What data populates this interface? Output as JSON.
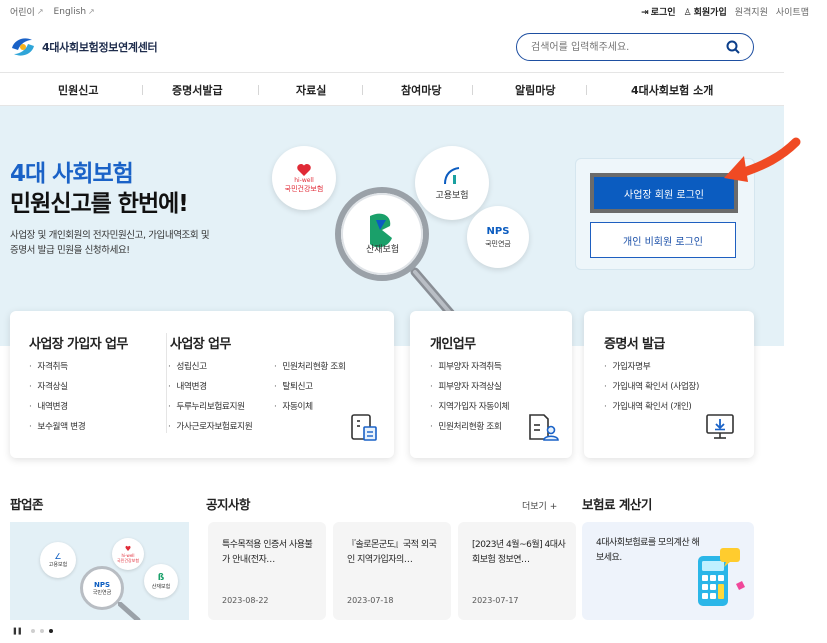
{
  "utility": {
    "lang_kids": "어린이",
    "lang_english": "English",
    "login": "로그인",
    "signup": "회원가입",
    "remote_support": "원격지원",
    "sitemap": "사이트맵"
  },
  "header": {
    "logo_text": "4대사회보험정보연계센터",
    "search_placeholder": "검색어를 입력해주세요."
  },
  "gnb": {
    "items": [
      "민원신고",
      "증명서발급",
      "자료실",
      "참여마당",
      "알림마당",
      "4대사회보험 소개"
    ]
  },
  "hero": {
    "title": "4대 사회보험",
    "subtitle": "민원신고를 한번에!",
    "desc_line1": "사업장 및 개인회원의 전자민원신고, 가입내역조회 및",
    "desc_line2": "증명서 발급 민원을 신청하세요!",
    "bubbles": {
      "health_brand": "hi-well",
      "health": "국민건강보험",
      "employment": "고용보험",
      "nps_brand": "NPS",
      "nps": "국민연금",
      "industrial": "산재보험"
    },
    "login_business": "사업장 회원 로그인",
    "login_guest": "개인 비회원 로그인"
  },
  "cards": {
    "biz_join": {
      "title": "사업장 가입자 업무",
      "items": [
        "자격취득",
        "자격상실",
        "내역변경",
        "보수월액 변경"
      ]
    },
    "biz_work": {
      "title": "사업장 업무",
      "items_col1": [
        "성립신고",
        "내역변경",
        "두루누리보험료지원",
        "가사근로자보험료지원"
      ],
      "items_col2": [
        "민원처리현황 조회",
        "탈퇴신고",
        "자동이체"
      ]
    },
    "personal": {
      "title": "개인업무",
      "items": [
        "피부양자 자격취득",
        "피부양자 자격상실",
        "지역가입자 자동이체",
        "민원처리현황 조회"
      ]
    },
    "certificate": {
      "title": "증명서 발급",
      "items": [
        "가입자명부",
        "가입내역 확인서 (사업장)",
        "가입내역 확인서 (개인)"
      ]
    }
  },
  "popup_zone": {
    "title": "팝업존",
    "mini_labels": {
      "employment": "고용보험",
      "health_brand": "hi-well",
      "health": "국민건강보험",
      "nps_brand": "NPS",
      "nps": "국민연금",
      "industrial": "산재보험"
    }
  },
  "notice": {
    "title": "공지사항",
    "more": "더보기 +",
    "items": [
      {
        "title": "특수목적용 인증서 사용불가 안내(전자…",
        "date": "2023-08-22"
      },
      {
        "title": "『솔로몬군도』국적 외국인 지역가입자의…",
        "date": "2023-07-18"
      },
      {
        "title": "[2023년 4월~6월] 4대사회보험 정보연…",
        "date": "2023-07-17"
      }
    ]
  },
  "calculator": {
    "title": "보험료 계산기",
    "desc": "4대사회보험료를 모의계산 해보세요."
  },
  "colors": {
    "brand_blue": "#0b5cc0",
    "hero_bg": "#e4f1f7",
    "arrow": "#f04a23"
  }
}
